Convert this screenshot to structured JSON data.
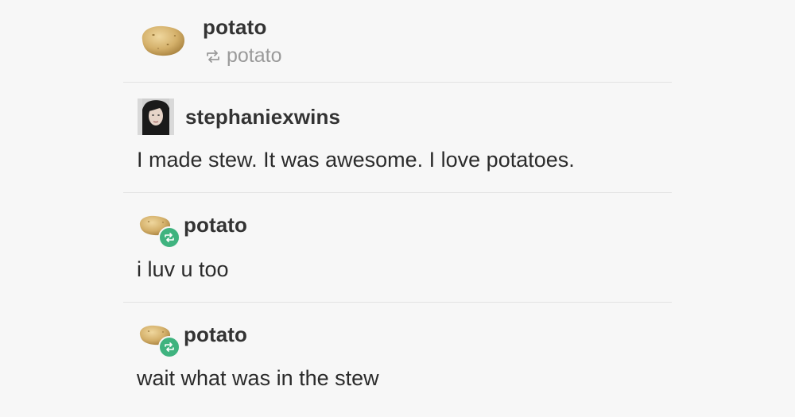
{
  "header": {
    "blog_name": "potato",
    "reblogged_from": "potato",
    "avatar_icon": "potato-avatar-icon",
    "reblog_icon": "reblog-icon"
  },
  "posts": [
    {
      "username": "stephaniexwins",
      "text": "I made stew. It was awesome. I love potatoes.",
      "avatar_icon": "user-avatar-photo"
    },
    {
      "username": "potato",
      "text": "i luv u too",
      "avatar_icon": "potato-avatar-icon",
      "badge_icon": "reblog-badge-icon"
    },
    {
      "username": "potato",
      "text": "wait what was in the stew",
      "avatar_icon": "potato-avatar-icon",
      "badge_icon": "reblog-badge-icon"
    }
  ],
  "colors": {
    "background": "#f7f7f7",
    "text": "#2b2b2b",
    "muted": "#9a9a9a",
    "divider": "#e3e3e3",
    "reblog_badge": "#3fb37f",
    "potato": "#d6b574"
  }
}
